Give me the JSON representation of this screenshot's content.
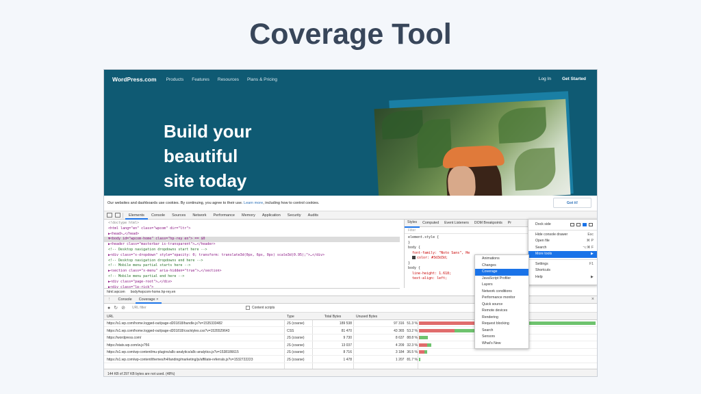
{
  "slide_title": "Coverage Tool",
  "site": {
    "logo": "WordPress.com",
    "nav": [
      "Products",
      "Features",
      "Resources",
      "Plans & Pricing"
    ],
    "login": "Log In",
    "cta": "Get Started",
    "hero_line1": "Build your",
    "hero_line2": "beautiful",
    "hero_line3": "site today"
  },
  "cookie": {
    "text_before": "Our websites and dashboards use cookies. By continuing, you agree to their use.",
    "link": "Learn more",
    "text_after": ", including how to control cookies.",
    "button": "Got it!"
  },
  "devtools": {
    "tabs": [
      "Elements",
      "Console",
      "Sources",
      "Network",
      "Performance",
      "Memory",
      "Application",
      "Security",
      "Audits"
    ],
    "active_tab": "Elements",
    "elements_lines": [
      "<!doctype html>",
      "<html lang=\"en\" class=\"wpcom\" dir=\"ltr\">",
      "  ▶<head>…</head>",
      "▼<body id=\"wpcom-home\" class=\"hp-rey en\"> == $0",
      "   ▶<header class=\"masterbar is-transparent\">…</header>",
      "     <!-- Desktop navigation dropdowns start here -->",
      "   ▶<div class=\"x-dropdown\" style=\"opacity: 0; transform: translate3d(0px, 6px, 0px) scale3d(0.95);\">…</div>",
      "     <!-- Desktop navigation dropdowns end here -->",
      "     <!-- Mobile menu partial starts here -->",
      "   ▶<section class=\"x-menu\" aria-hidden=\"true\">…</section>",
      "     <!-- Mobile menu partial end here -->",
      "   ▶<div class=\"page-root\">…</div>",
      "   ▶<div class=\"lp-rick\">"
    ],
    "styles_tabs": [
      "Styles",
      "Computed",
      "Event Listeners",
      "DOM Breakpoints",
      "Pr"
    ],
    "filter_placeholder": "Filter",
    "style_lines": [
      "element.style {",
      "}",
      "body {",
      "font-family: \"Noto Sans\", He",
      "color: #3d3d3d;",
      "}",
      "body {",
      "line-height: 1.618;",
      "text-align: left;"
    ],
    "breadcrumb": [
      "html.wpcom",
      "body#wpcom-home.hp-rey.en"
    ],
    "drawer_tabs": [
      "Console",
      "Coverage"
    ],
    "url_filter_placeholder": "URL filter",
    "content_scripts_label": "Content scripts",
    "coverage_headers": [
      "URL",
      "Type",
      "Total Bytes",
      "Unused Bytes"
    ],
    "coverage_rows": [
      {
        "url": "https://s1.wp.com/home.logged-out/page-d201818/bundle.js?v=1535333482",
        "type": "JS (coarse)",
        "total": "189 538",
        "unused": "97 316",
        "pct": "51.3 %"
      },
      {
        "url": "https://s1.wp.com/home.logged-out/page-d201818/css/styles.css?v=1535529643",
        "type": "CSS",
        "total": "81 470",
        "unused": "43 365",
        "pct": "53.2 %"
      },
      {
        "url": "https://wordpress.com/",
        "type": "JS (coarse)",
        "total": "9 730",
        "unused": "8 637",
        "pct": "88.8 %"
      },
      {
        "url": "https://stats.wp.com/w.js?56",
        "type": "JS (coarse)",
        "total": "13 037",
        "unused": "4 209",
        "pct": "32.3 %"
      },
      {
        "url": "https://s1.wp.com/wp-content/mu-plugins/a8c-analytics/a8c-analytics.js?v=1538186615",
        "type": "JS (coarse)",
        "total": "8 716",
        "unused": "3 184",
        "pct": "36.5 %"
      },
      {
        "url": "https://s1.wp.com/wp-content/themes/h4/landing/marketing/js/affiliate-referrals.js?v=1532722223",
        "type": "JS (coarse)",
        "total": "1 478",
        "unused": "1 207",
        "pct": "81.7 %"
      }
    ],
    "coverage_fractions": [
      {
        "total": 1.0,
        "unused": 0.513
      },
      {
        "total": 0.43,
        "unused": 0.532
      },
      {
        "total": 0.051,
        "unused": 0.888
      },
      {
        "total": 0.069,
        "unused": 0.323
      },
      {
        "total": 0.046,
        "unused": 0.365
      },
      {
        "total": 0.008,
        "unused": 0.817
      }
    ],
    "status": "144 KB of 297 KB bytes are not used. (48%)",
    "main_menu": {
      "dock_label": "Dock side",
      "items": [
        {
          "label": "Hide console drawer",
          "shortcut": "Esc"
        },
        {
          "label": "Open file",
          "shortcut": "⌘ P"
        },
        {
          "label": "Search",
          "shortcut": "⌥⌘ F"
        },
        {
          "label": "More tools",
          "shortcut": "▶"
        },
        {
          "label": "Settings",
          "shortcut": "F1"
        },
        {
          "label": "Shortcuts",
          "shortcut": ""
        },
        {
          "label": "Help",
          "shortcut": "▶"
        }
      ]
    },
    "more_tools": [
      "Animations",
      "Changes",
      "Coverage",
      "JavaScript Profiler",
      "Layers",
      "Network conditions",
      "Performance monitor",
      "Quick source",
      "Remote devices",
      "Rendering",
      "Request blocking",
      "Search",
      "Sensors",
      "What's New"
    ],
    "more_tools_selected": "Coverage"
  },
  "colors": {
    "accent": "#1a73e8",
    "used_bar": "#e06c6c",
    "unused_bar": "#6ec36e",
    "site_bg": "#0f5a73"
  }
}
